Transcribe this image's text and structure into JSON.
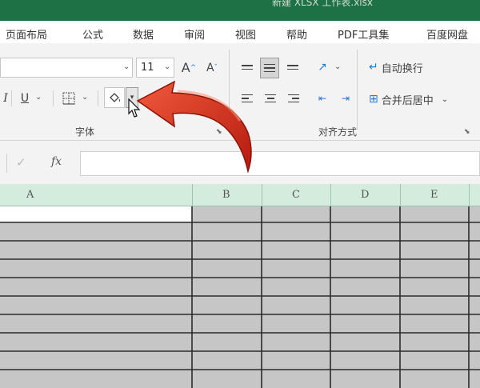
{
  "title": "新建 XLSX 工作表.xlsx",
  "tabs": [
    "页面布局",
    "公式",
    "数据",
    "审阅",
    "视图",
    "帮助",
    "PDF工具集",
    "百度网盘"
  ],
  "font": {
    "size": "11",
    "grow_label": "A",
    "shrink_label": "A",
    "italic_label": "I",
    "underline_label": "U",
    "group_label": "字体"
  },
  "alignment": {
    "wrap_label": "自动换行",
    "merge_label": "合并后居中",
    "group_label": "对齐方式"
  },
  "formula_bar": {
    "fx_label": "fx",
    "value": ""
  },
  "columns": [
    "A",
    "B",
    "C",
    "D",
    "E"
  ],
  "colors": {
    "title_bar": "#1e7145",
    "header_bg": "#d3ecde",
    "cell_fill": "#c6c6c6",
    "arrow": "#d62a1a"
  }
}
